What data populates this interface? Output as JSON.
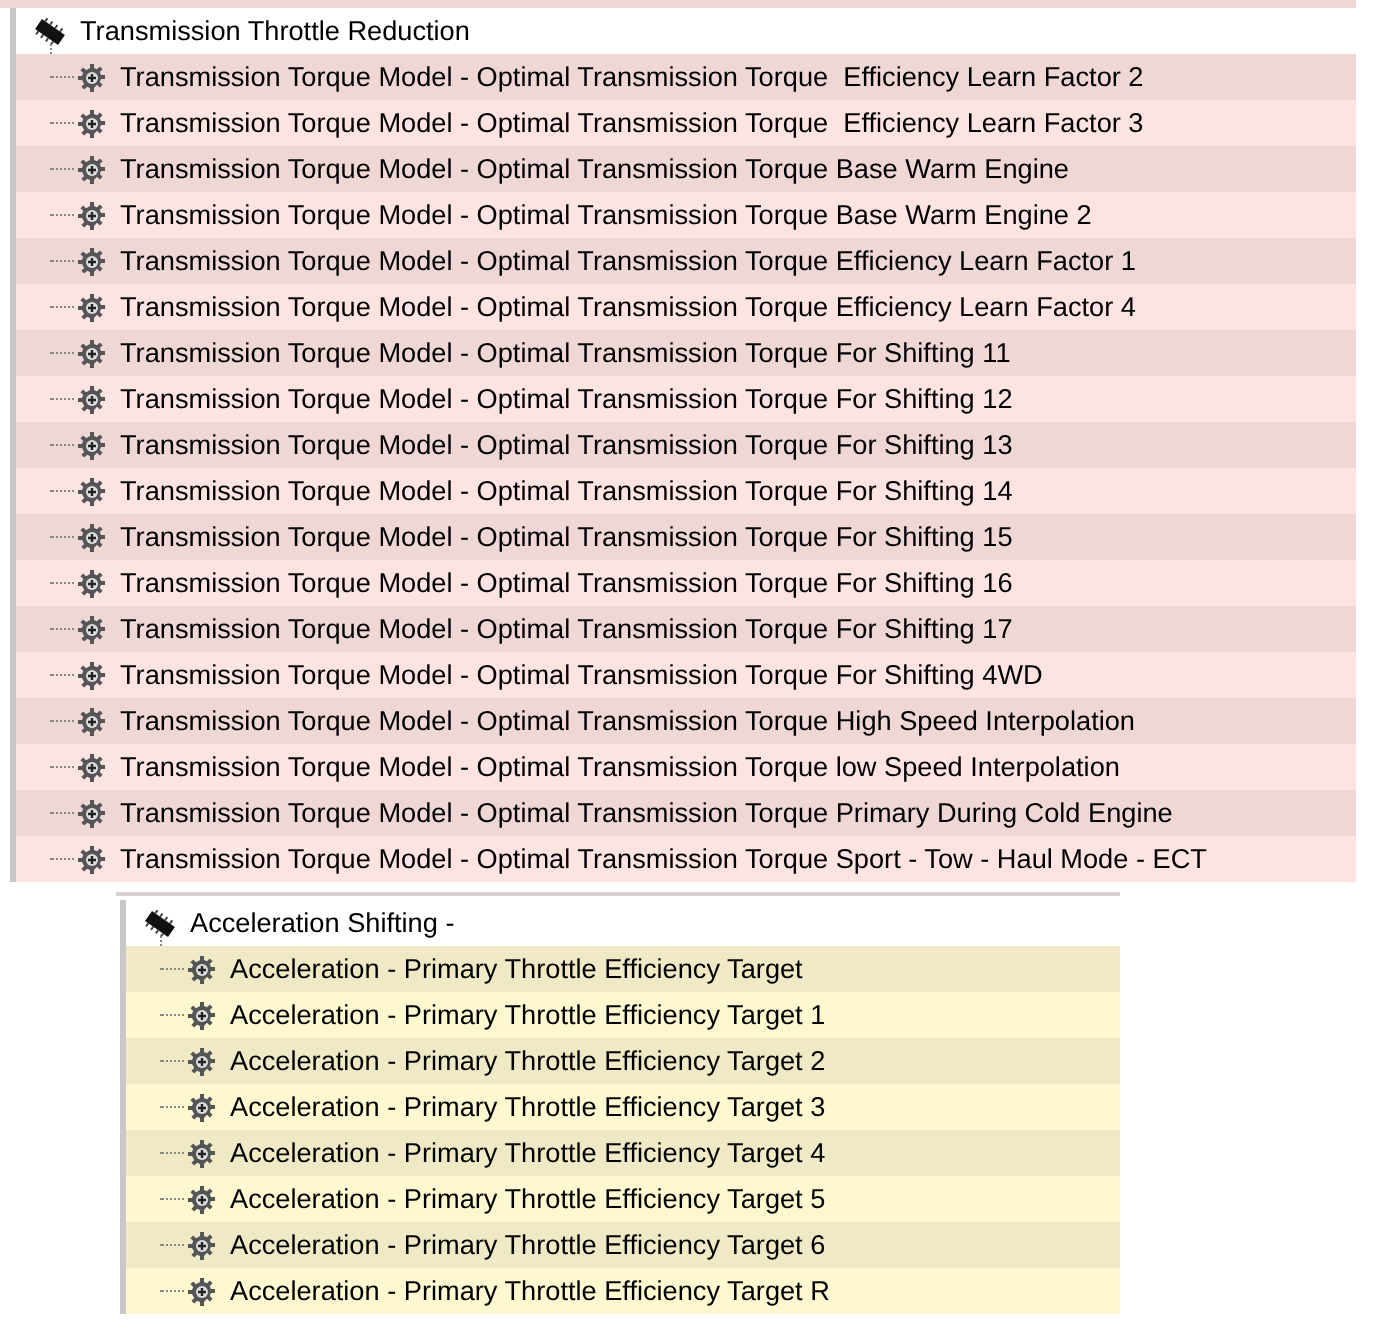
{
  "groups": [
    {
      "title": "Transmission Throttle Reduction",
      "color": "#fde4e2",
      "kind": "root",
      "rows": [
        {
          "label": "Transmission Torque Model - Optimal Transmission Torque  Efficiency Learn Factor 2"
        },
        {
          "label": "Transmission Torque Model - Optimal Transmission Torque  Efficiency Learn Factor 3"
        },
        {
          "label": "Transmission Torque Model - Optimal Transmission Torque Base Warm Engine"
        },
        {
          "label": "Transmission Torque Model - Optimal Transmission Torque Base Warm Engine 2"
        },
        {
          "label": "Transmission Torque Model - Optimal Transmission Torque Efficiency Learn Factor 1"
        },
        {
          "label": "Transmission Torque Model - Optimal Transmission Torque Efficiency Learn Factor 4"
        },
        {
          "label": "Transmission Torque Model - Optimal Transmission Torque For Shifting 11"
        },
        {
          "label": "Transmission Torque Model - Optimal Transmission Torque For Shifting 12"
        },
        {
          "label": "Transmission Torque Model - Optimal Transmission Torque For Shifting 13"
        },
        {
          "label": "Transmission Torque Model - Optimal Transmission Torque For Shifting 14"
        },
        {
          "label": "Transmission Torque Model - Optimal Transmission Torque For Shifting 15"
        },
        {
          "label": "Transmission Torque Model - Optimal Transmission Torque For Shifting 16"
        },
        {
          "label": "Transmission Torque Model - Optimal Transmission Torque For Shifting 17"
        },
        {
          "label": "Transmission Torque Model - Optimal Transmission Torque For Shifting 4WD"
        },
        {
          "label": "Transmission Torque Model - Optimal Transmission Torque High Speed Interpolation"
        },
        {
          "label": "Transmission Torque Model - Optimal Transmission Torque low Speed Interpolation"
        },
        {
          "label": "Transmission Torque Model - Optimal Transmission Torque Primary During Cold Engine"
        },
        {
          "label": "Transmission Torque Model - Optimal Transmission Torque Sport - Tow - Haul Mode - ECT"
        }
      ]
    },
    {
      "title": "Acceleration Shifting -",
      "color": "#fdf8d0",
      "kind": "nested",
      "rows": [
        {
          "label": "Acceleration - Primary Throttle Efficiency Target"
        },
        {
          "label": "Acceleration - Primary Throttle Efficiency Target 1"
        },
        {
          "label": "Acceleration - Primary Throttle Efficiency Target 2"
        },
        {
          "label": "Acceleration - Primary Throttle Efficiency Target 3"
        },
        {
          "label": "Acceleration - Primary Throttle Efficiency Target 4"
        },
        {
          "label": "Acceleration - Primary Throttle Efficiency Target 5"
        },
        {
          "label": "Acceleration - Primary Throttle Efficiency Target 6"
        },
        {
          "label": "Acceleration - Primary Throttle Efficiency Target R"
        }
      ]
    }
  ]
}
